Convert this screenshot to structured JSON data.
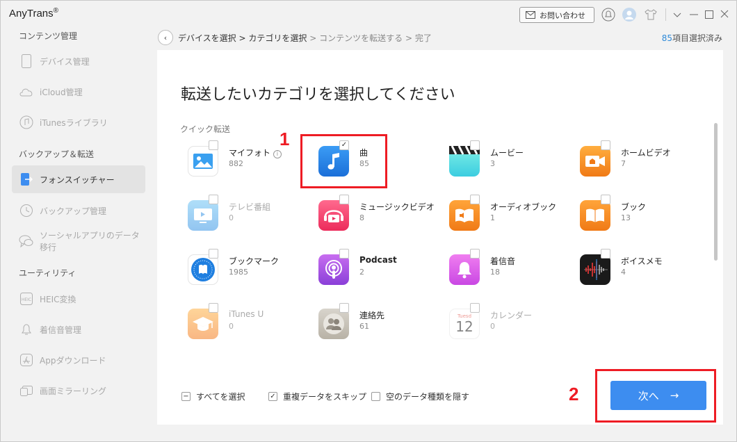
{
  "app": {
    "name": "AnyTrans",
    "reg": "®"
  },
  "titlebar": {
    "contact_label": "お問い合わせ"
  },
  "sidebar": {
    "sections": [
      {
        "label": "コンテンツ管理"
      },
      {
        "label": "バックアップ＆転送"
      },
      {
        "label": "ユーティリティ"
      }
    ],
    "items": [
      {
        "label": "デバイス管理",
        "icon": "phone-icon"
      },
      {
        "label": "iCloud管理",
        "icon": "cloud-icon"
      },
      {
        "label": "iTunesライブラリ",
        "icon": "music-note-icon"
      },
      {
        "label": "フォンスイッチャー",
        "icon": "phone-switch-icon",
        "active": true
      },
      {
        "label": "バックアップ管理",
        "icon": "backup-clock-icon"
      },
      {
        "label": "ソーシャルアプリのデータ移行",
        "icon": "chat-bubble-icon"
      },
      {
        "label": "HEIC変換",
        "icon": "heic-icon"
      },
      {
        "label": "着信音管理",
        "icon": "bell-icon"
      },
      {
        "label": "Appダウンロード",
        "icon": "app-store-icon"
      },
      {
        "label": "画面ミラーリング",
        "icon": "screen-mirror-icon"
      }
    ],
    "collapse_glyph": "<"
  },
  "breadcrumb": {
    "step1": "デバイスを選択",
    "sep": ">",
    "step2": "カテゴリを選択",
    "step3": "コンテンツを転送する",
    "step4": "完了"
  },
  "selection": {
    "count": "85",
    "suffix": "項目選択済み"
  },
  "main": {
    "title": "転送したいカテゴリを選択してください",
    "quick_label": "クイック転送",
    "categories": [
      {
        "name": "マイフォト",
        "count": "882",
        "icon": "photo-icon",
        "info": "i"
      },
      {
        "name": "曲",
        "count": "85",
        "icon": "music-icon",
        "checked": true
      },
      {
        "name": "ムービー",
        "count": "3",
        "icon": "clapperboard-icon"
      },
      {
        "name": "ホームビデオ",
        "count": "7",
        "icon": "home-video-icon"
      },
      {
        "name": "テレビ番組",
        "count": "0",
        "icon": "tv-icon",
        "disabled": true
      },
      {
        "name": "ミュージックビデオ",
        "count": "8",
        "icon": "music-video-icon"
      },
      {
        "name": "オーディオブック",
        "count": "1",
        "icon": "audiobook-icon"
      },
      {
        "name": "ブック",
        "count": "13",
        "icon": "book-icon"
      },
      {
        "name": "ブックマーク",
        "count": "1985",
        "icon": "bookmark-compass-icon"
      },
      {
        "name": "Podcast",
        "count": "2",
        "icon": "podcast-icon"
      },
      {
        "name": "着信音",
        "count": "18",
        "icon": "ringtone-bell-icon"
      },
      {
        "name": "ボイスメモ",
        "count": "4",
        "icon": "voice-memo-icon"
      },
      {
        "name": "iTunes U",
        "count": "0",
        "icon": "itunes-u-icon",
        "disabled": true
      },
      {
        "name": "連絡先",
        "count": "61",
        "icon": "contacts-icon"
      },
      {
        "name": "カレンダー",
        "count": "0",
        "icon": "calendar-icon",
        "disabled": true,
        "cal_day": "Tuesd",
        "cal_date": "12"
      }
    ],
    "options": {
      "select_all": "すべてを選択",
      "skip_duplicates": "重複データをスキップ",
      "hide_empty": "空のデータ種類を隠す"
    },
    "next_label": "次へ",
    "next_arrow": "→"
  },
  "annotations": {
    "step1": "1",
    "step2": "2"
  },
  "colors": {
    "accent": "#3d8df0",
    "highlight": "#ee1c24"
  }
}
